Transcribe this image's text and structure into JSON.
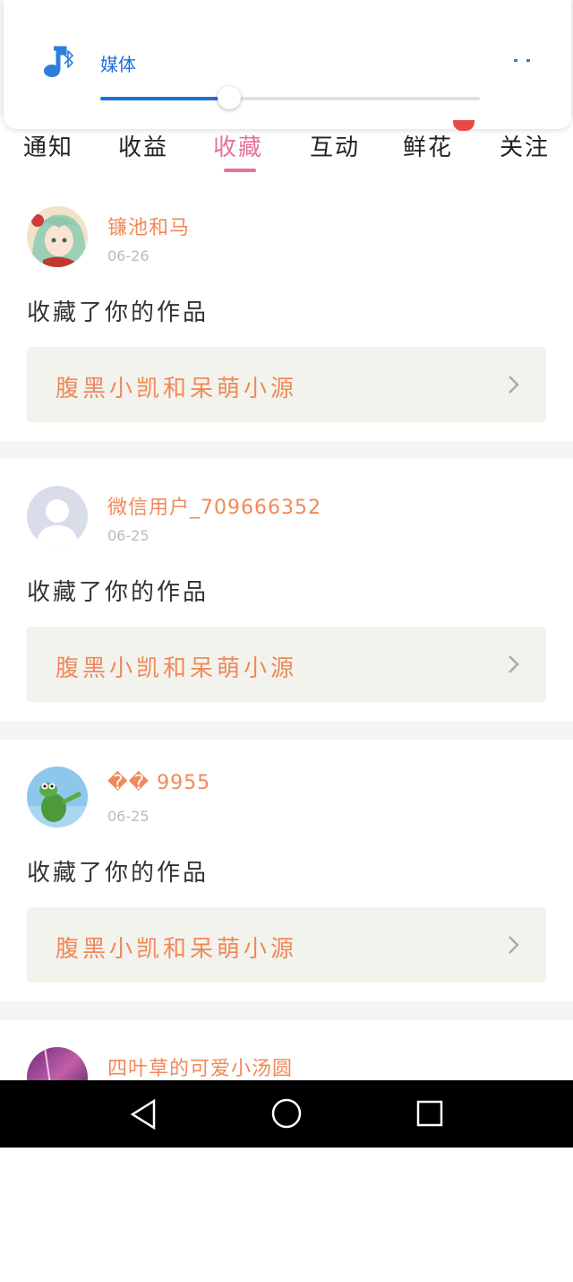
{
  "volume": {
    "label": "媒体",
    "level": 0.34,
    "accent": "#1e6fd9",
    "icons": [
      "music-note-icon",
      "bluetooth-icon",
      "expand-dots-icon"
    ]
  },
  "tabs": [
    {
      "label": "通知"
    },
    {
      "label": "收益"
    },
    {
      "label": "收藏",
      "active": true
    },
    {
      "label": "互动"
    },
    {
      "label": "鲜花",
      "badge": true
    },
    {
      "label": "关注"
    }
  ],
  "colors": {
    "accent": "#e8719a",
    "name": "#f0895a",
    "badge": "#e84a4a"
  },
  "items": [
    {
      "user": "镰池和马",
      "date": "06-26",
      "action": "收藏了你的作品",
      "work": "腹黑小凯和呆萌小源",
      "avatar": "anime-avatar"
    },
    {
      "user": "微信用户_709666352",
      "date": "06-25",
      "action": "收藏了你的作品",
      "work": "腹黑小凯和呆萌小源",
      "avatar": "default-avatar"
    },
    {
      "user": "�� 9955",
      "date": "06-25",
      "action": "收藏了你的作品",
      "work": "腹黑小凯和呆萌小源",
      "avatar": "frog-avatar"
    },
    {
      "user": "四叶草的可爱小汤圆",
      "date": "",
      "action": "",
      "work": "",
      "avatar": "purple-avatar"
    }
  ],
  "navbar": {
    "icons": [
      "back-triangle-icon",
      "home-circle-icon",
      "recents-square-icon"
    ]
  }
}
